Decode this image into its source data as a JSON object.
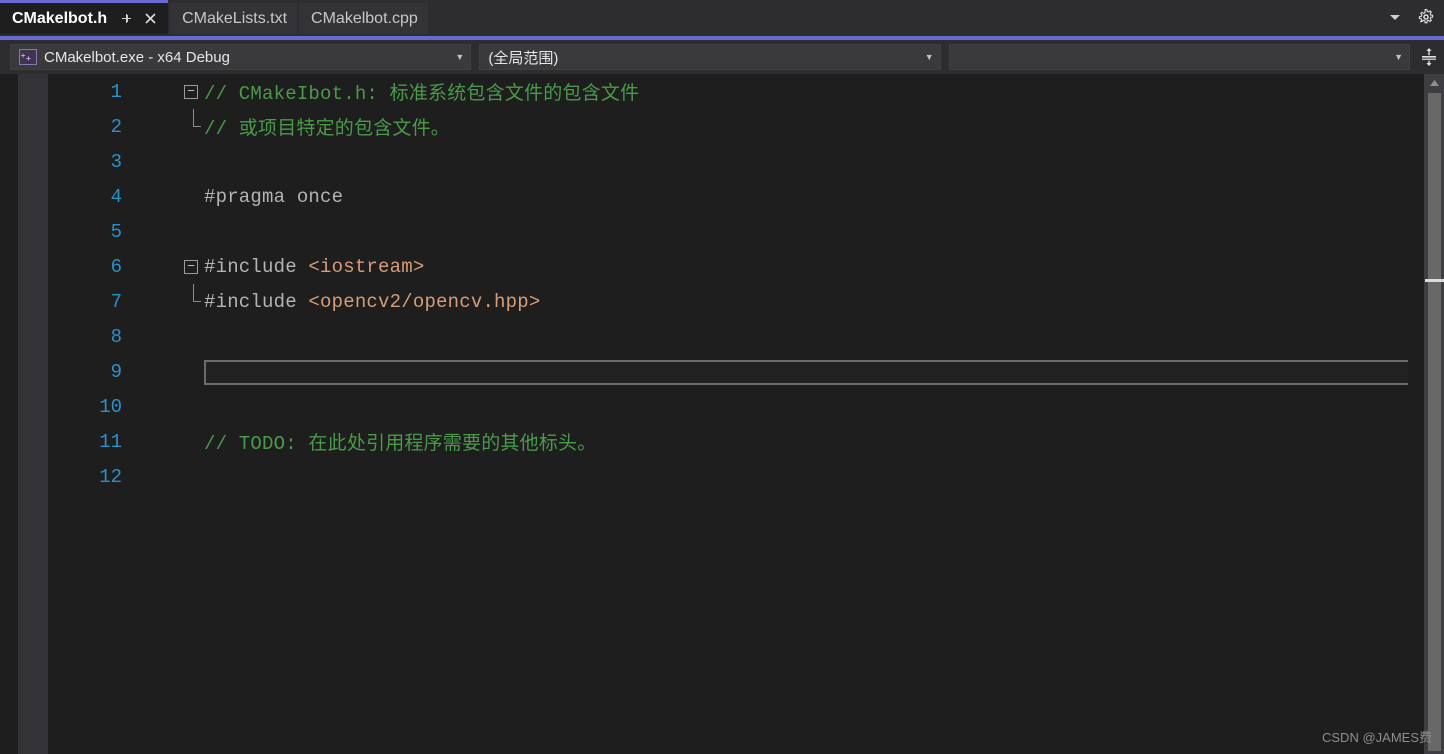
{
  "tabs": [
    {
      "label": "CMakelbot.h",
      "active": true,
      "pin_icon": "pin-icon",
      "close_icon": "close-icon"
    },
    {
      "label": "CMakeLists.txt",
      "active": false
    },
    {
      "label": "CMakelbot.cpp",
      "active": false
    }
  ],
  "tabstrip_right": {
    "dropdown_icon": "chevron-down-icon",
    "settings_icon": "gear-icon"
  },
  "navbar": {
    "project_combo": {
      "icon": "cpp-file-icon",
      "icon_glyph": "+₊",
      "value": "CMakelbot.exe - x64 Debug",
      "arrow": "▼"
    },
    "scope_combo": {
      "value": "(全局范围)",
      "arrow": "▼"
    },
    "member_combo": {
      "value": "",
      "arrow": "▼"
    },
    "split_button_icon": "split-window-icon"
  },
  "editor": {
    "file_name": "CMakelbot.h",
    "lines": [
      {
        "num": "1",
        "fold": "collapse-box",
        "segments": [
          {
            "text": "// CMakeIbot.h: 标准系统包含文件的包含文件",
            "cls": "cmt"
          }
        ]
      },
      {
        "num": "2",
        "fold": "fold-end",
        "segments": [
          {
            "text": "// 或项目特定的包含文件。",
            "cls": "cmt"
          }
        ]
      },
      {
        "num": "3",
        "fold": "none",
        "segments": []
      },
      {
        "num": "4",
        "fold": "none",
        "segments": [
          {
            "text": "#pragma once",
            "cls": "pre"
          }
        ]
      },
      {
        "num": "5",
        "fold": "none",
        "segments": []
      },
      {
        "num": "6",
        "fold": "collapse-box",
        "segments": [
          {
            "text": "#include ",
            "cls": "pre"
          },
          {
            "text": "<iostream>",
            "cls": "str"
          }
        ]
      },
      {
        "num": "7",
        "fold": "fold-end",
        "segments": [
          {
            "text": "#include ",
            "cls": "pre"
          },
          {
            "text": "<opencv2/opencv.hpp>",
            "cls": "str"
          }
        ]
      },
      {
        "num": "8",
        "fold": "none",
        "segments": []
      },
      {
        "num": "9",
        "fold": "none",
        "segments": [],
        "editbox": true
      },
      {
        "num": "10",
        "fold": "none",
        "segments": []
      },
      {
        "num": "11",
        "fold": "none",
        "segments": [
          {
            "text": "// TODO: 在此处引用程序需要的其他标头。",
            "cls": "cmt"
          }
        ]
      },
      {
        "num": "12",
        "fold": "none",
        "segments": []
      }
    ]
  },
  "scrollbar": {
    "up_arrow_icon": "scroll-up-icon",
    "cursor_marker": "caret-position-marker"
  },
  "watermark": {
    "text": "CSDN @JAMES费"
  },
  "colors": {
    "accent_purple": "#6a69d2",
    "editor_bg": "#1e1e1e",
    "chrome_bg": "#2d2d30",
    "comment_green": "#4a9a4a",
    "string_orange": "#d69d78",
    "linenum_blue": "#2b91c9",
    "preproc_gray": "#b4b4b4"
  }
}
